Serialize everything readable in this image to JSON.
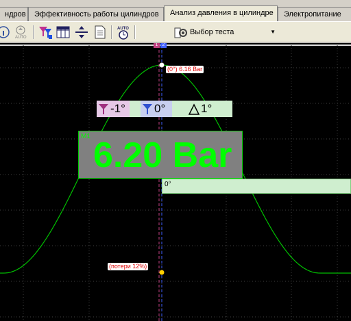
{
  "tabs": [
    {
      "label": "ндров",
      "active": false
    },
    {
      "label": "Эффективность работы цилиндров",
      "active": false
    },
    {
      "label": "Анализ давления в цилиндре",
      "active": true
    },
    {
      "label": "Электропитание",
      "active": false
    }
  ],
  "toolbar": {
    "auto_label": "AUTO",
    "test_select_label": "Выбор теста",
    "icons": [
      "info-icon",
      "zoom-auto-icon",
      "filter-icon",
      "grid-icon",
      "split-icon",
      "document-icon",
      "auto-timer-icon",
      "tools-icon"
    ]
  },
  "scope": {
    "marker_label_1": "1",
    "marker_label_2": "2",
    "peak_readout": "(0°) 6.16 Bar",
    "delta": {
      "cursor1": "-1°",
      "cursor2": "0°",
      "delta": "1°"
    },
    "measurement": {
      "tag": "M1",
      "value": "6.20 Bar"
    },
    "axis_label": "0°",
    "loss_readout": "(потери 12%)"
  },
  "colors": {
    "trace": "#00c000",
    "grid": "#404040",
    "cursor1": "#c04080",
    "cursor2": "#4060ff",
    "readout_text": "#e00000",
    "measurement_text": "#00ff00",
    "measurement_bg": "#808080",
    "info_bg": "#cfeecf"
  }
}
